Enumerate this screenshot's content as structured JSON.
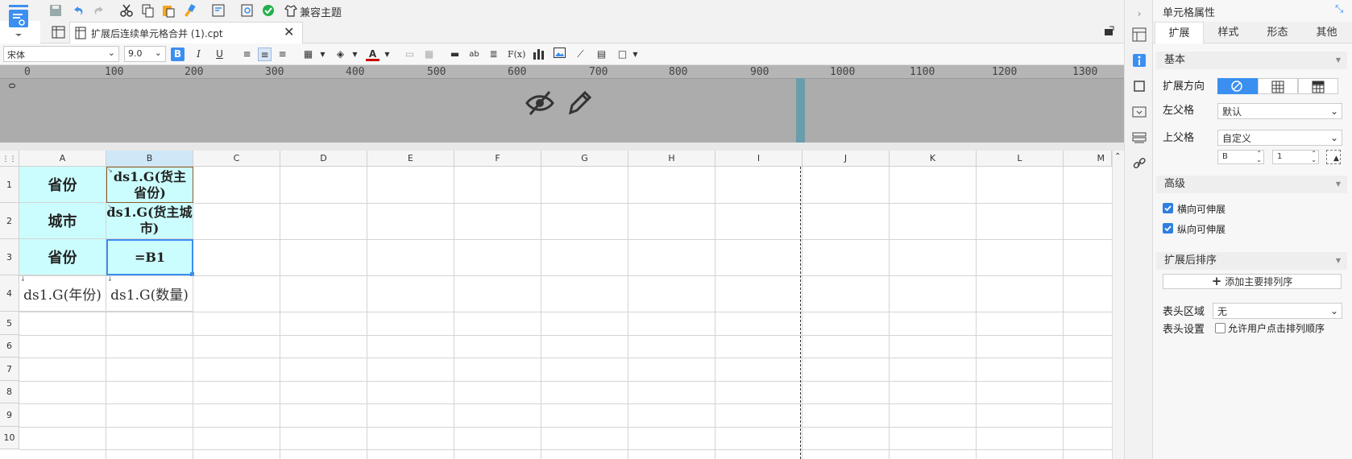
{
  "toolbar": {
    "theme_label": "兼容主题"
  },
  "tab": {
    "filename": "扩展后连续单元格合并 (1).cpt"
  },
  "format": {
    "font": "宋体",
    "size": "9.0"
  },
  "ruler": {
    "ticks": [
      "0",
      "100",
      "200",
      "300",
      "400",
      "500",
      "600",
      "700",
      "800",
      "900",
      "1000",
      "1100",
      "1200",
      "1300"
    ],
    "vertical_tick": "0"
  },
  "grid": {
    "columns": [
      "A",
      "B",
      "C",
      "D",
      "E",
      "F",
      "G",
      "H",
      "I",
      "J",
      "K",
      "L",
      "M"
    ],
    "rows": [
      "1",
      "2",
      "3",
      "4",
      "5",
      "6",
      "7",
      "8",
      "9",
      "10"
    ],
    "cells": {
      "a1": "省份",
      "b1": "ds1.G(货主省份)",
      "a2": "城市",
      "b2": "ds1.G(货主城市)",
      "a3": "省份",
      "b3": "=B1",
      "a4": "ds1.G(年份)",
      "b4": "ds1.G(数量)"
    }
  },
  "panel": {
    "title": "单元格属性",
    "tabs": [
      "扩展",
      "样式",
      "形态",
      "其他"
    ],
    "sections": {
      "basic": "基本",
      "advanced": "高级",
      "sort": "扩展后排序"
    },
    "expand_direction_label": "扩展方向",
    "left_parent_label": "左父格",
    "left_parent_value": "默认",
    "top_parent_label": "上父格",
    "top_parent_value": "自定义",
    "top_parent_col": "B",
    "top_parent_row": "1",
    "h_extend_label": "横向可伸展",
    "v_extend_label": "纵向可伸展",
    "add_sort_label": "添加主要排列序",
    "header_area_label": "表头区域",
    "header_area_value": "无",
    "header_setting_label": "表头设置",
    "allow_sort_label": "允许用户点击排列顺序"
  },
  "colors": {
    "accent": "#3b8ff0",
    "cyan_cell": "#ccfdfe",
    "check": "#2f7fe0"
  }
}
